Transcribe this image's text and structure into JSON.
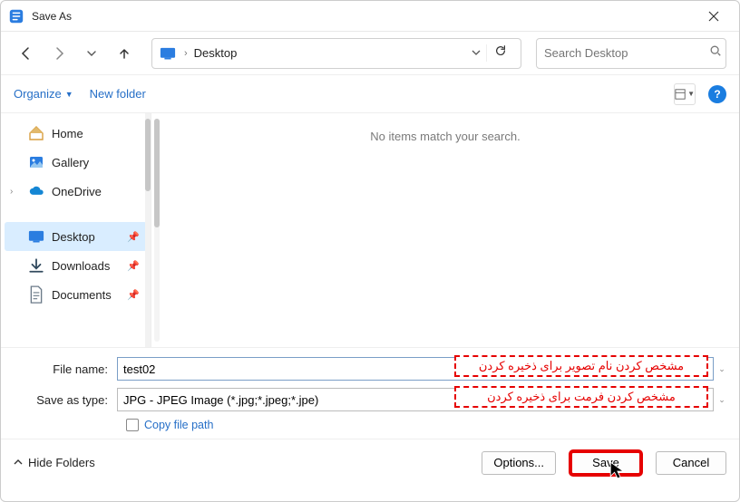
{
  "window": {
    "title": "Save As"
  },
  "path": {
    "crumb": "Desktop"
  },
  "search": {
    "placeholder": "Search Desktop"
  },
  "toolbar": {
    "organize": "Organize",
    "new_folder": "New folder"
  },
  "sidebar": {
    "home": "Home",
    "gallery": "Gallery",
    "onedrive": "OneDrive",
    "desktop": "Desktop",
    "downloads": "Downloads",
    "documents": "Documents"
  },
  "content": {
    "empty": "No items match your search."
  },
  "form": {
    "filename_label": "File name:",
    "filename_value": "test02",
    "type_label": "Save as type:",
    "type_value": "JPG - JPEG Image (*.jpg;*.jpeg;*.jpe)",
    "copy_path": "Copy file path"
  },
  "annotation": {
    "filename": "مشخص کردن نام تصویر برای ذخیره کردن",
    "filetype": "مشخص کردن فرمت برای ذخیره کردن"
  },
  "footer": {
    "hide_folders": "Hide Folders",
    "options": "Options...",
    "save": "Save",
    "cancel": "Cancel"
  }
}
